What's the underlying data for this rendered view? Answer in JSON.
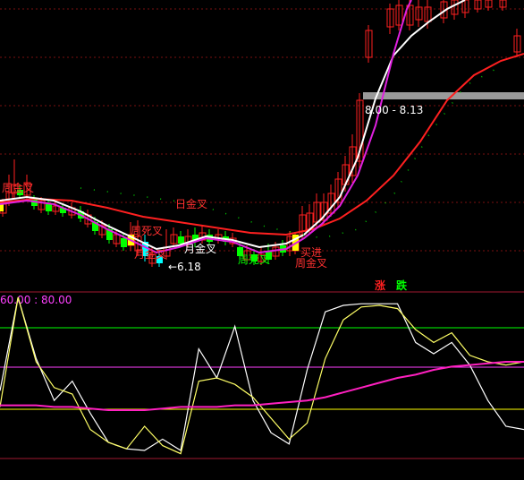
{
  "chart_data": [
    {
      "type": "candlestick",
      "panel": "price",
      "annotations": [
        {
          "text": "日金叉",
          "color": "#ff3030"
        },
        {
          "text": "周金叉",
          "color": "#ff3030"
        },
        {
          "text": "月金叉",
          "color": "#ffffff"
        },
        {
          "text": "月金叉",
          "color": "#ff3030"
        },
        {
          "text": "周死叉",
          "color": "#ff3030"
        },
        {
          "text": "周死叉",
          "color": "#00ff00"
        },
        {
          "text": "买进",
          "color": "#ff3030"
        },
        {
          "text": "周金叉",
          "color": "#ff3030"
        },
        {
          "text": "←6.18",
          "color": "#ffffff"
        },
        {
          "text": "8.00 - 8.13",
          "color": "#ffffff"
        }
      ],
      "colors": {
        "up": "#ff2020",
        "down": "#00ffff",
        "ma_white": "#ffffff",
        "ma_magenta": "#e020e0",
        "ma_red": "#ff2020",
        "band": "#9a9a9a"
      }
    },
    {
      "type": "line",
      "panel": "oscillator",
      "header": "60.00 : 80.00",
      "header_color": "#ff40ff",
      "legend": [
        {
          "label": "涨",
          "color": "#ff2020"
        },
        {
          "label": "跌",
          "color": "#00ff00"
        }
      ],
      "levels": [
        {
          "value": 80,
          "color": "#00ff00"
        },
        {
          "value": 60,
          "color": "#ff40ff"
        },
        {
          "value": 40,
          "color": "#ffff00"
        }
      ],
      "ylim": [
        0,
        100
      ],
      "series": [
        {
          "color": "#ffffff",
          "values": [
            42,
            100,
            62,
            36,
            48,
            28,
            10,
            6,
            5,
            12,
            5,
            68,
            50,
            82,
            36,
            16,
            9,
            55,
            91,
            95,
            96,
            96,
            96,
            72,
            65,
            72,
            58,
            36,
            20,
            18
          ]
        },
        {
          "color": "#ffff66",
          "values": [
            32,
            100,
            60,
            44,
            40,
            18,
            10,
            6,
            20,
            8,
            3,
            48,
            50,
            46,
            38,
            25,
            12,
            22,
            62,
            86,
            94,
            95,
            93,
            80,
            72,
            78,
            64,
            60,
            58,
            60
          ]
        },
        {
          "color": "#ff20c0",
          "values": [
            33,
            33,
            33,
            32,
            32,
            31,
            30,
            30,
            30,
            31,
            32,
            32,
            32,
            33,
            33,
            34,
            35,
            36,
            38,
            41,
            44,
            47,
            50,
            52,
            55,
            57,
            58,
            59,
            60,
            60
          ]
        }
      ]
    }
  ]
}
